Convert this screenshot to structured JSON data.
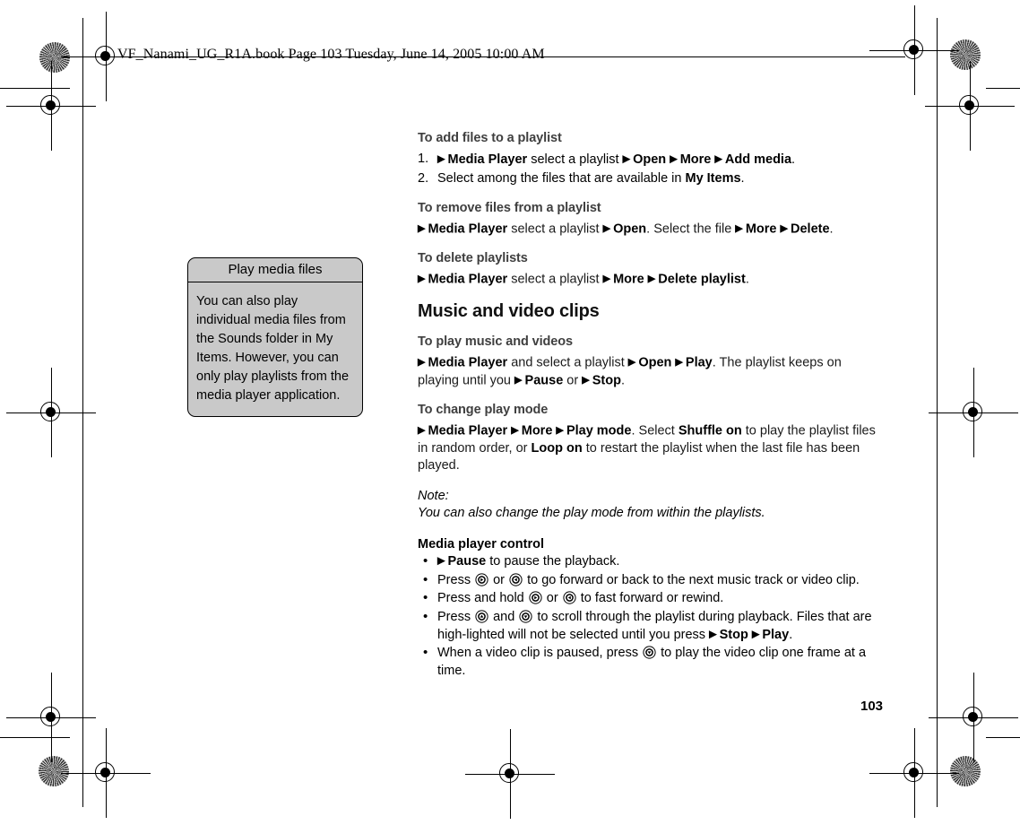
{
  "header": {
    "running_head": "VF_Nanami_UG_R1A.book  Page 103  Tuesday, June 14, 2005  10:00 AM"
  },
  "folio": {
    "page_number": "103"
  },
  "callout": {
    "title": "Play media files",
    "body": "You can also play individual media files from the Sounds folder in My Items. However, you can only play playlists from the media player application."
  },
  "content": {
    "add_files": {
      "heading": "To add files to a playlist",
      "steps": [
        {
          "num": "1.",
          "parts": [
            {
              "t": "▶ ",
              "bold": true,
              "arrow": true
            },
            {
              "t": "Media Player",
              "bold": true
            },
            {
              "t": " select a playlist "
            },
            {
              "t": "▶ ",
              "bold": true,
              "arrow": true
            },
            {
              "t": "Open",
              "bold": true
            },
            {
              "t": " "
            },
            {
              "t": "▶ ",
              "bold": true,
              "arrow": true
            },
            {
              "t": "More",
              "bold": true
            },
            {
              "t": " "
            },
            {
              "t": "▶ ",
              "bold": true,
              "arrow": true
            },
            {
              "t": "Add media",
              "bold": true
            },
            {
              "t": "."
            }
          ]
        },
        {
          "num": "2.",
          "parts": [
            {
              "t": "Select among the files that are available in "
            },
            {
              "t": "My Items",
              "bold": true
            },
            {
              "t": "."
            }
          ]
        }
      ]
    },
    "remove_files": {
      "heading": "To remove files from a playlist",
      "parts": [
        {
          "t": "▶ ",
          "bold": true,
          "arrow": true
        },
        {
          "t": "Media Player",
          "bold": true
        },
        {
          "t": " select a playlist "
        },
        {
          "t": "▶ ",
          "bold": true,
          "arrow": true
        },
        {
          "t": "Open",
          "bold": true
        },
        {
          "t": ". Select the file "
        },
        {
          "t": "▶ ",
          "bold": true,
          "arrow": true
        },
        {
          "t": "More",
          "bold": true
        },
        {
          "t": " "
        },
        {
          "t": "▶ ",
          "bold": true,
          "arrow": true
        },
        {
          "t": "Delete",
          "bold": true
        },
        {
          "t": "."
        }
      ]
    },
    "delete_playlists": {
      "heading": "To delete playlists",
      "parts": [
        {
          "t": "▶ ",
          "bold": true,
          "arrow": true
        },
        {
          "t": "Media Player",
          "bold": true
        },
        {
          "t": " select a playlist "
        },
        {
          "t": "▶ ",
          "bold": true,
          "arrow": true
        },
        {
          "t": "More",
          "bold": true
        },
        {
          "t": " "
        },
        {
          "t": "▶ ",
          "bold": true,
          "arrow": true
        },
        {
          "t": "Delete playlist",
          "bold": true
        },
        {
          "t": "."
        }
      ]
    },
    "chapter_heading": "Music and video clips",
    "play_music": {
      "heading": "To play music and videos",
      "parts": [
        {
          "t": "▶ ",
          "bold": true,
          "arrow": true
        },
        {
          "t": "Media Player",
          "bold": true
        },
        {
          "t": " and select a playlist "
        },
        {
          "t": "▶ ",
          "bold": true,
          "arrow": true
        },
        {
          "t": "Open",
          "bold": true
        },
        {
          "t": " "
        },
        {
          "t": "▶ ",
          "bold": true,
          "arrow": true
        },
        {
          "t": "Play",
          "bold": true
        },
        {
          "t": ". The playlist keeps on playing until you "
        },
        {
          "t": "▶ ",
          "bold": true,
          "arrow": true
        },
        {
          "t": "Pause",
          "bold": true
        },
        {
          "t": " or "
        },
        {
          "t": "▶ ",
          "bold": true,
          "arrow": true
        },
        {
          "t": "Stop",
          "bold": true
        },
        {
          "t": "."
        }
      ]
    },
    "change_play_mode": {
      "heading": "To change play mode",
      "parts": [
        {
          "t": "▶ ",
          "bold": true,
          "arrow": true
        },
        {
          "t": "Media Player",
          "bold": true
        },
        {
          "t": " "
        },
        {
          "t": "▶ ",
          "bold": true,
          "arrow": true
        },
        {
          "t": "More",
          "bold": true
        },
        {
          "t": " "
        },
        {
          "t": "▶ ",
          "bold": true,
          "arrow": true
        },
        {
          "t": "Play mode",
          "bold": true
        },
        {
          "t": ". Select "
        },
        {
          "t": "Shuffle on",
          "bold": true
        },
        {
          "t": " to play the playlist files in random order, or "
        },
        {
          "t": "Loop on",
          "bold": true
        },
        {
          "t": " to restart the playlist when the last file has been played."
        }
      ]
    },
    "note": {
      "label": "Note:",
      "text": "You can also change the play mode from within the playlists."
    },
    "media_player_control": {
      "heading": "Media player control",
      "bullets": [
        {
          "parts": [
            {
              "t": "▶ ",
              "bold": true,
              "arrow": true
            },
            {
              "t": "Pause",
              "bold": true
            },
            {
              "t": " to pause the playback."
            }
          ]
        },
        {
          "parts": [
            {
              "t": "Press "
            },
            {
              "icon": "nav-key-right-icon"
            },
            {
              "t": " or "
            },
            {
              "icon": "nav-key-left-icon"
            },
            {
              "t": " to go forward or back to the next music track or video clip."
            }
          ]
        },
        {
          "parts": [
            {
              "t": "Press and hold "
            },
            {
              "icon": "nav-key-right-icon"
            },
            {
              "t": " or "
            },
            {
              "icon": "nav-key-left-icon"
            },
            {
              "t": " to fast forward or rewind."
            }
          ]
        },
        {
          "parts": [
            {
              "t": "Press "
            },
            {
              "icon": "nav-key-up-icon"
            },
            {
              "t": " and "
            },
            {
              "icon": "nav-key-down-icon"
            },
            {
              "t": " to scroll through the playlist during playback. Files that are high-lighted will not be selected until you press "
            },
            {
              "t": "▶ ",
              "bold": true,
              "arrow": true
            },
            {
              "t": "Stop",
              "bold": true
            },
            {
              "t": " "
            },
            {
              "t": "▶ ",
              "bold": true,
              "arrow": true
            },
            {
              "t": "Play",
              "bold": true
            },
            {
              "t": "."
            }
          ]
        },
        {
          "parts": [
            {
              "t": "When a video clip is paused, press "
            },
            {
              "icon": "nav-key-down-icon"
            },
            {
              "t": " to play the video clip one frame at a time."
            }
          ]
        }
      ]
    }
  },
  "colors": {
    "callout_fill": "#c9c9c9",
    "subheading": "#3f3f3f",
    "text": "#1a1a1a"
  }
}
